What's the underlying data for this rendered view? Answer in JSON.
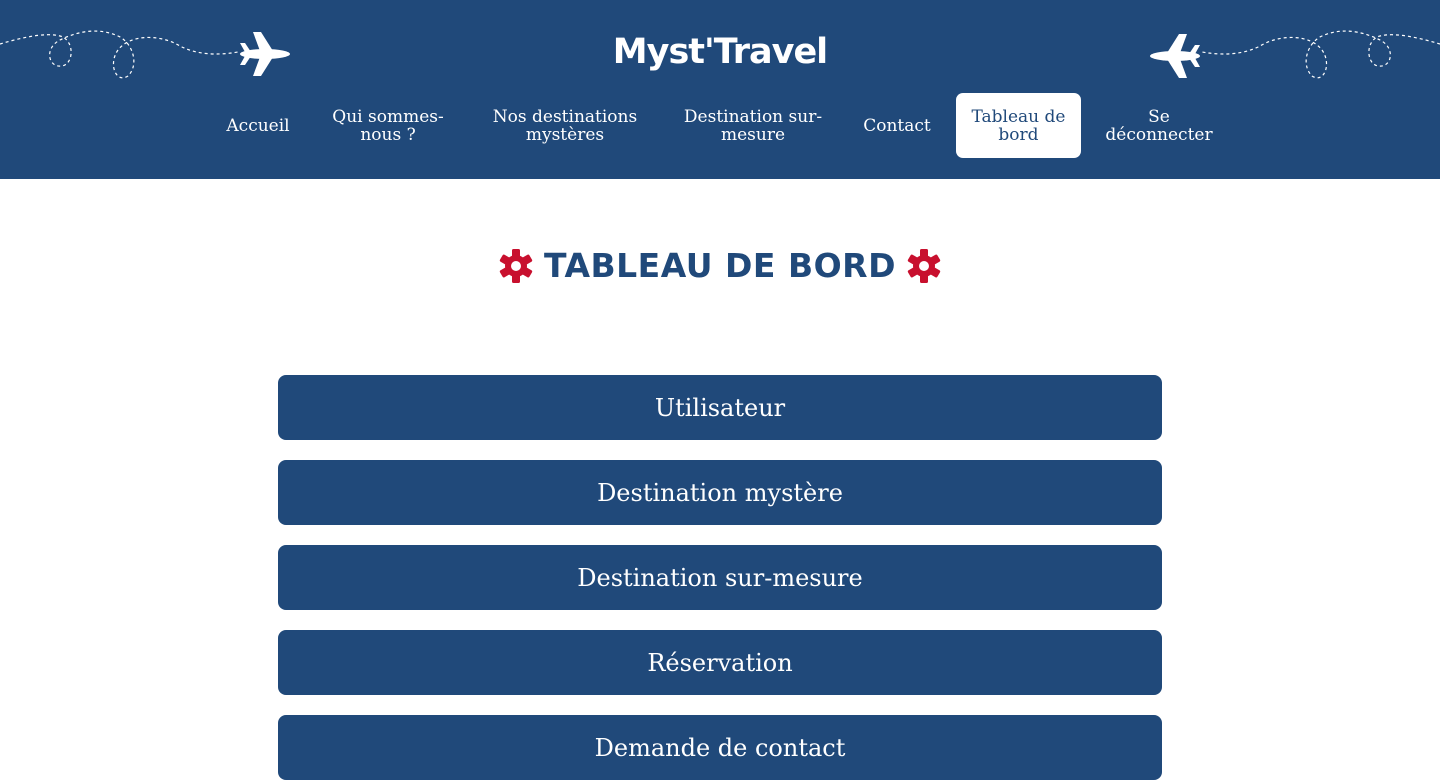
{
  "site": {
    "title": "Myst'Travel"
  },
  "nav": [
    {
      "label": "Accueil"
    },
    {
      "label": "Qui sommes-nous ?"
    },
    {
      "label": "Nos destinations mystères"
    },
    {
      "label": "Destination sur-mesure"
    },
    {
      "label": "Contact"
    },
    {
      "label": "Tableau de bord",
      "active": true
    },
    {
      "label": "Se déconnecter"
    }
  ],
  "page": {
    "title": "TABLEAU DE BORD",
    "title_icon": "gear-icon"
  },
  "menu": [
    {
      "label": "Utilisateur"
    },
    {
      "label": "Destination mystère"
    },
    {
      "label": "Destination sur-mesure"
    },
    {
      "label": "Réservation"
    },
    {
      "label": "Demande de contact"
    }
  ],
  "colors": {
    "primary": "#20497a",
    "accent": "#c8102e",
    "background": "#ffffff"
  }
}
